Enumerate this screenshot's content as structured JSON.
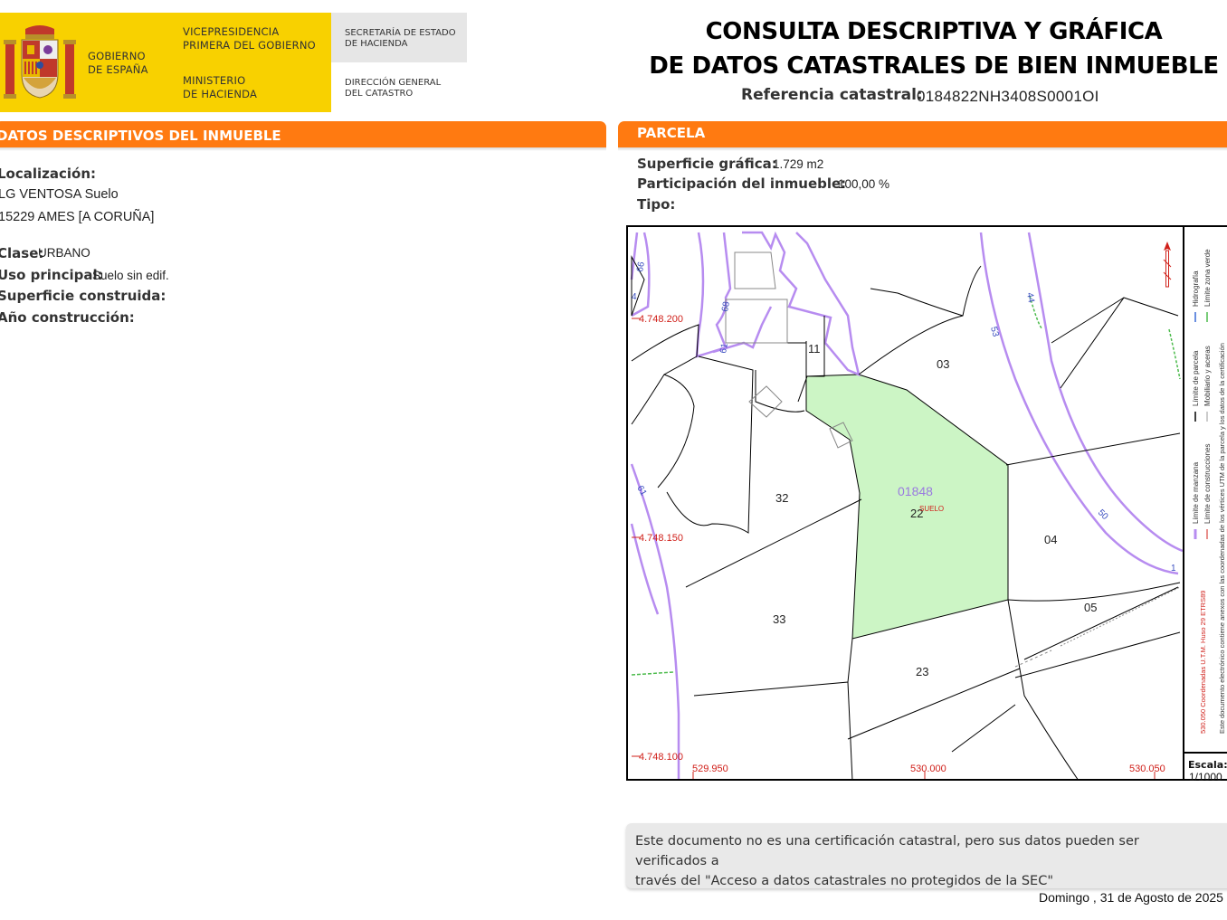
{
  "logo": {
    "gobierno": [
      "GOBIERNO",
      "DE ESPAÑA"
    ],
    "vicepresidencia": [
      "VICEPRESIDENCIA",
      "PRIMERA DEL GOBIERNO"
    ],
    "ministerio": [
      "MINISTERIO",
      "DE HACIENDA"
    ],
    "secretaria": [
      "SECRETARÍA DE ESTADO",
      "DE HACIENDA"
    ],
    "direccion": [
      "DIRECCIÓN GENERAL",
      "DEL CATASTRO"
    ]
  },
  "header": {
    "title_line1": "CONSULTA DESCRIPTIVA Y GRÁFICA",
    "title_line2": "DE DATOS CATASTRALES DE BIEN INMUEBLE",
    "ref_label": "Referencia catastral:",
    "ref_value": "0184822NH3408S0001OI"
  },
  "left": {
    "section_title": "DATOS DESCRIPTIVOS DEL INMUEBLE",
    "localizacion_label": "Localización:",
    "address_line1": "LG VENTOSA  Suelo",
    "address_line2": "15229 AMES [A CORUÑA]",
    "clase_label": "Clase:",
    "clase_value": "URBANO",
    "uso_label": "Uso principal:",
    "uso_value": "Suelo sin edif.",
    "superficie_label": "Superficie construida:",
    "anio_label": "Año construcción:"
  },
  "right": {
    "section_title": "PARCELA",
    "superficie_label": "Superficie gráfica:",
    "superficie_value": "1.729 m2",
    "participacion_label": "Participación del inmueble:",
    "participacion_value": "100,00 %",
    "tipo_label": "Tipo:"
  },
  "map": {
    "coord_labels": {
      "y_200": "4.748.200",
      "y_150": "4.748.150",
      "y_100": "4.748.100",
      "x_950": "529.950",
      "x_000": "530.000",
      "x_050": "530.050"
    },
    "parcel_labels": {
      "p03": "03",
      "p04": "04",
      "p05": "05",
      "p11": "11",
      "p22": "22",
      "p23": "23",
      "p32": "32",
      "p33": "33"
    },
    "highlight_code": "01848",
    "highlight_sub": "SUELO",
    "street_numbers": {
      "n66": "66",
      "n68": "68",
      "n61a": "61",
      "n61b": "61",
      "n44": "44",
      "n53": "53",
      "n50": "50",
      "n4": "4",
      "n1": "1"
    },
    "colors": {
      "parcel_fill": "#ccf5c5",
      "manzana_line": "#b78cf0",
      "coord_text": "#d0201a",
      "parcel_line": "#000000"
    },
    "legend": {
      "line1a": "Límite de manzana",
      "line1b": "Límite de parcela",
      "line1c": "Hidrografía",
      "line2a": "Límite de construcciones",
      "line2b": "Mobiliario y aceras",
      "line2c": "Límite zona verde",
      "coords": "530.050 Coordenadas U.T.M. Huso 29 ETRS89",
      "doc_note": "Este documento electrónico contiene anexos con las coordenadas de los vértices UTM de la parcela y los datos de la certificación"
    },
    "scale_label": "Escala:",
    "scale_value": "1/1000"
  },
  "footer": {
    "note_line1": "Este documento no es una certificación catastral, pero sus datos pueden ser verificados a",
    "note_line2": "través del \"Acceso a datos catastrales no protegidos de la SEC\"",
    "date": "Domingo , 31 de Agosto de 2025"
  }
}
